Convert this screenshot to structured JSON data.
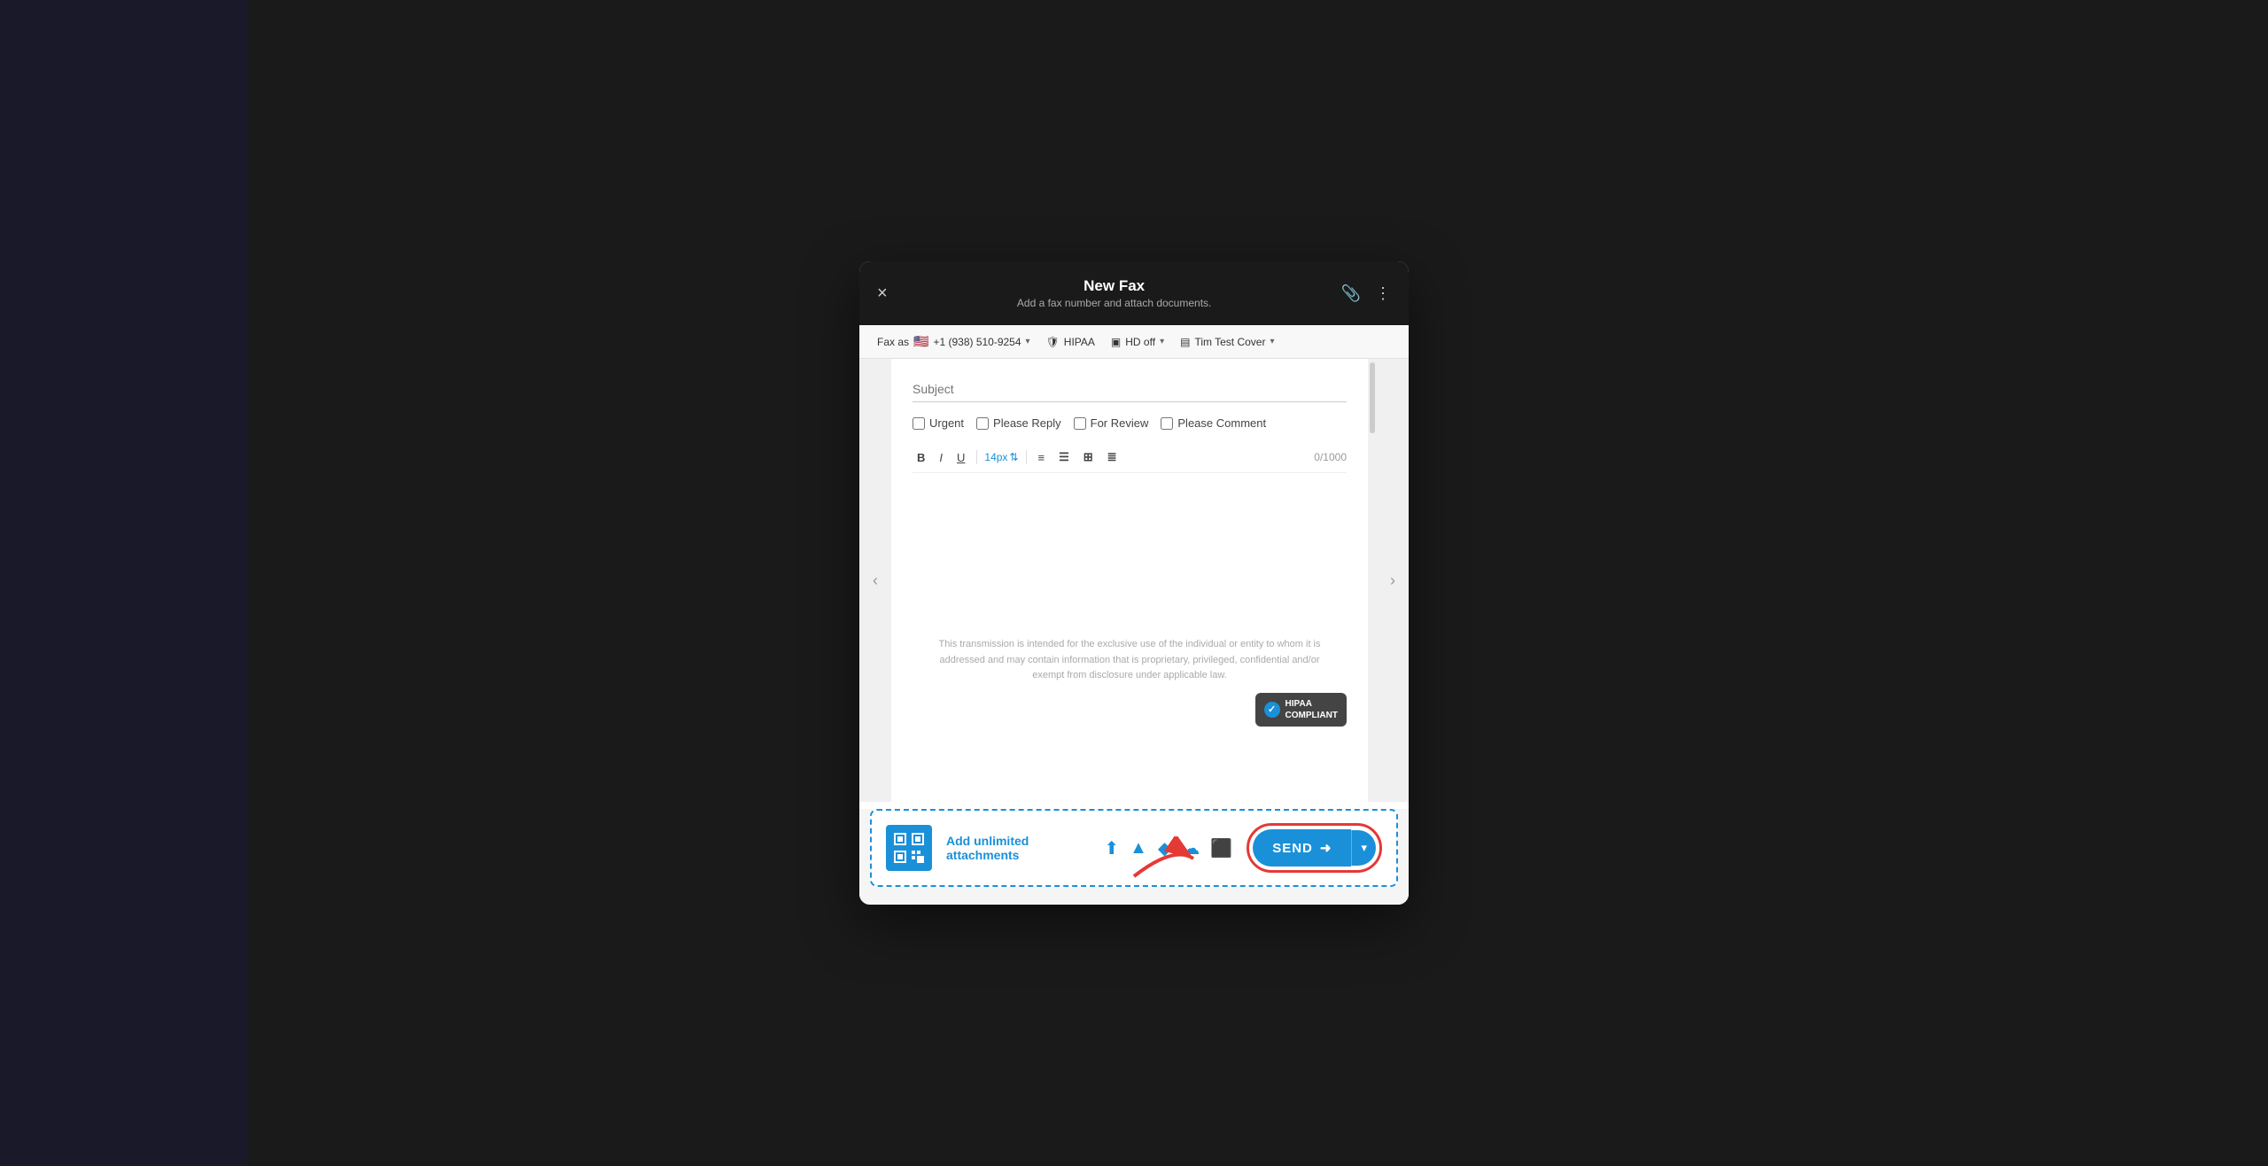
{
  "modal": {
    "title": "New Fax",
    "subtitle": "Add a fax number and attach documents.",
    "close_label": "×"
  },
  "toolbar": {
    "fax_as_label": "Fax as",
    "phone_number": "+1 (938) 510-9254",
    "hipaa_label": "HIPAA",
    "hd_label": "HD off",
    "cover_label": "Tim Test Cover",
    "chevron": "▾"
  },
  "form": {
    "subject_placeholder": "Subject",
    "checkboxes": [
      {
        "id": "urgent",
        "label": "Urgent",
        "checked": false
      },
      {
        "id": "please-reply",
        "label": "Please Reply",
        "checked": false
      },
      {
        "id": "for-review",
        "label": "For Review",
        "checked": false
      },
      {
        "id": "please-comment",
        "label": "Please Comment",
        "checked": false
      }
    ],
    "font_size": "14px",
    "char_count": "0/1000",
    "compose_placeholder": "",
    "disclaimer": "This transmission is intended for the exclusive use of the individual or entity to whom it is addressed and may contain information that is proprietary, privileged, confidential and/or exempt from disclosure under applicable law.",
    "hipaa_badge_line1": "HIPAA",
    "hipaa_badge_line2": "COMPLIANT"
  },
  "attachments": {
    "add_label": "Add unlimited attachments"
  },
  "send_button": {
    "label": "SEND",
    "arrow": "➜"
  },
  "format_buttons": {
    "bold": "B",
    "italic": "I",
    "underline": "U",
    "align": "≡",
    "list_ordered": "☰",
    "image": "⊞",
    "list_bullet": "≣"
  }
}
